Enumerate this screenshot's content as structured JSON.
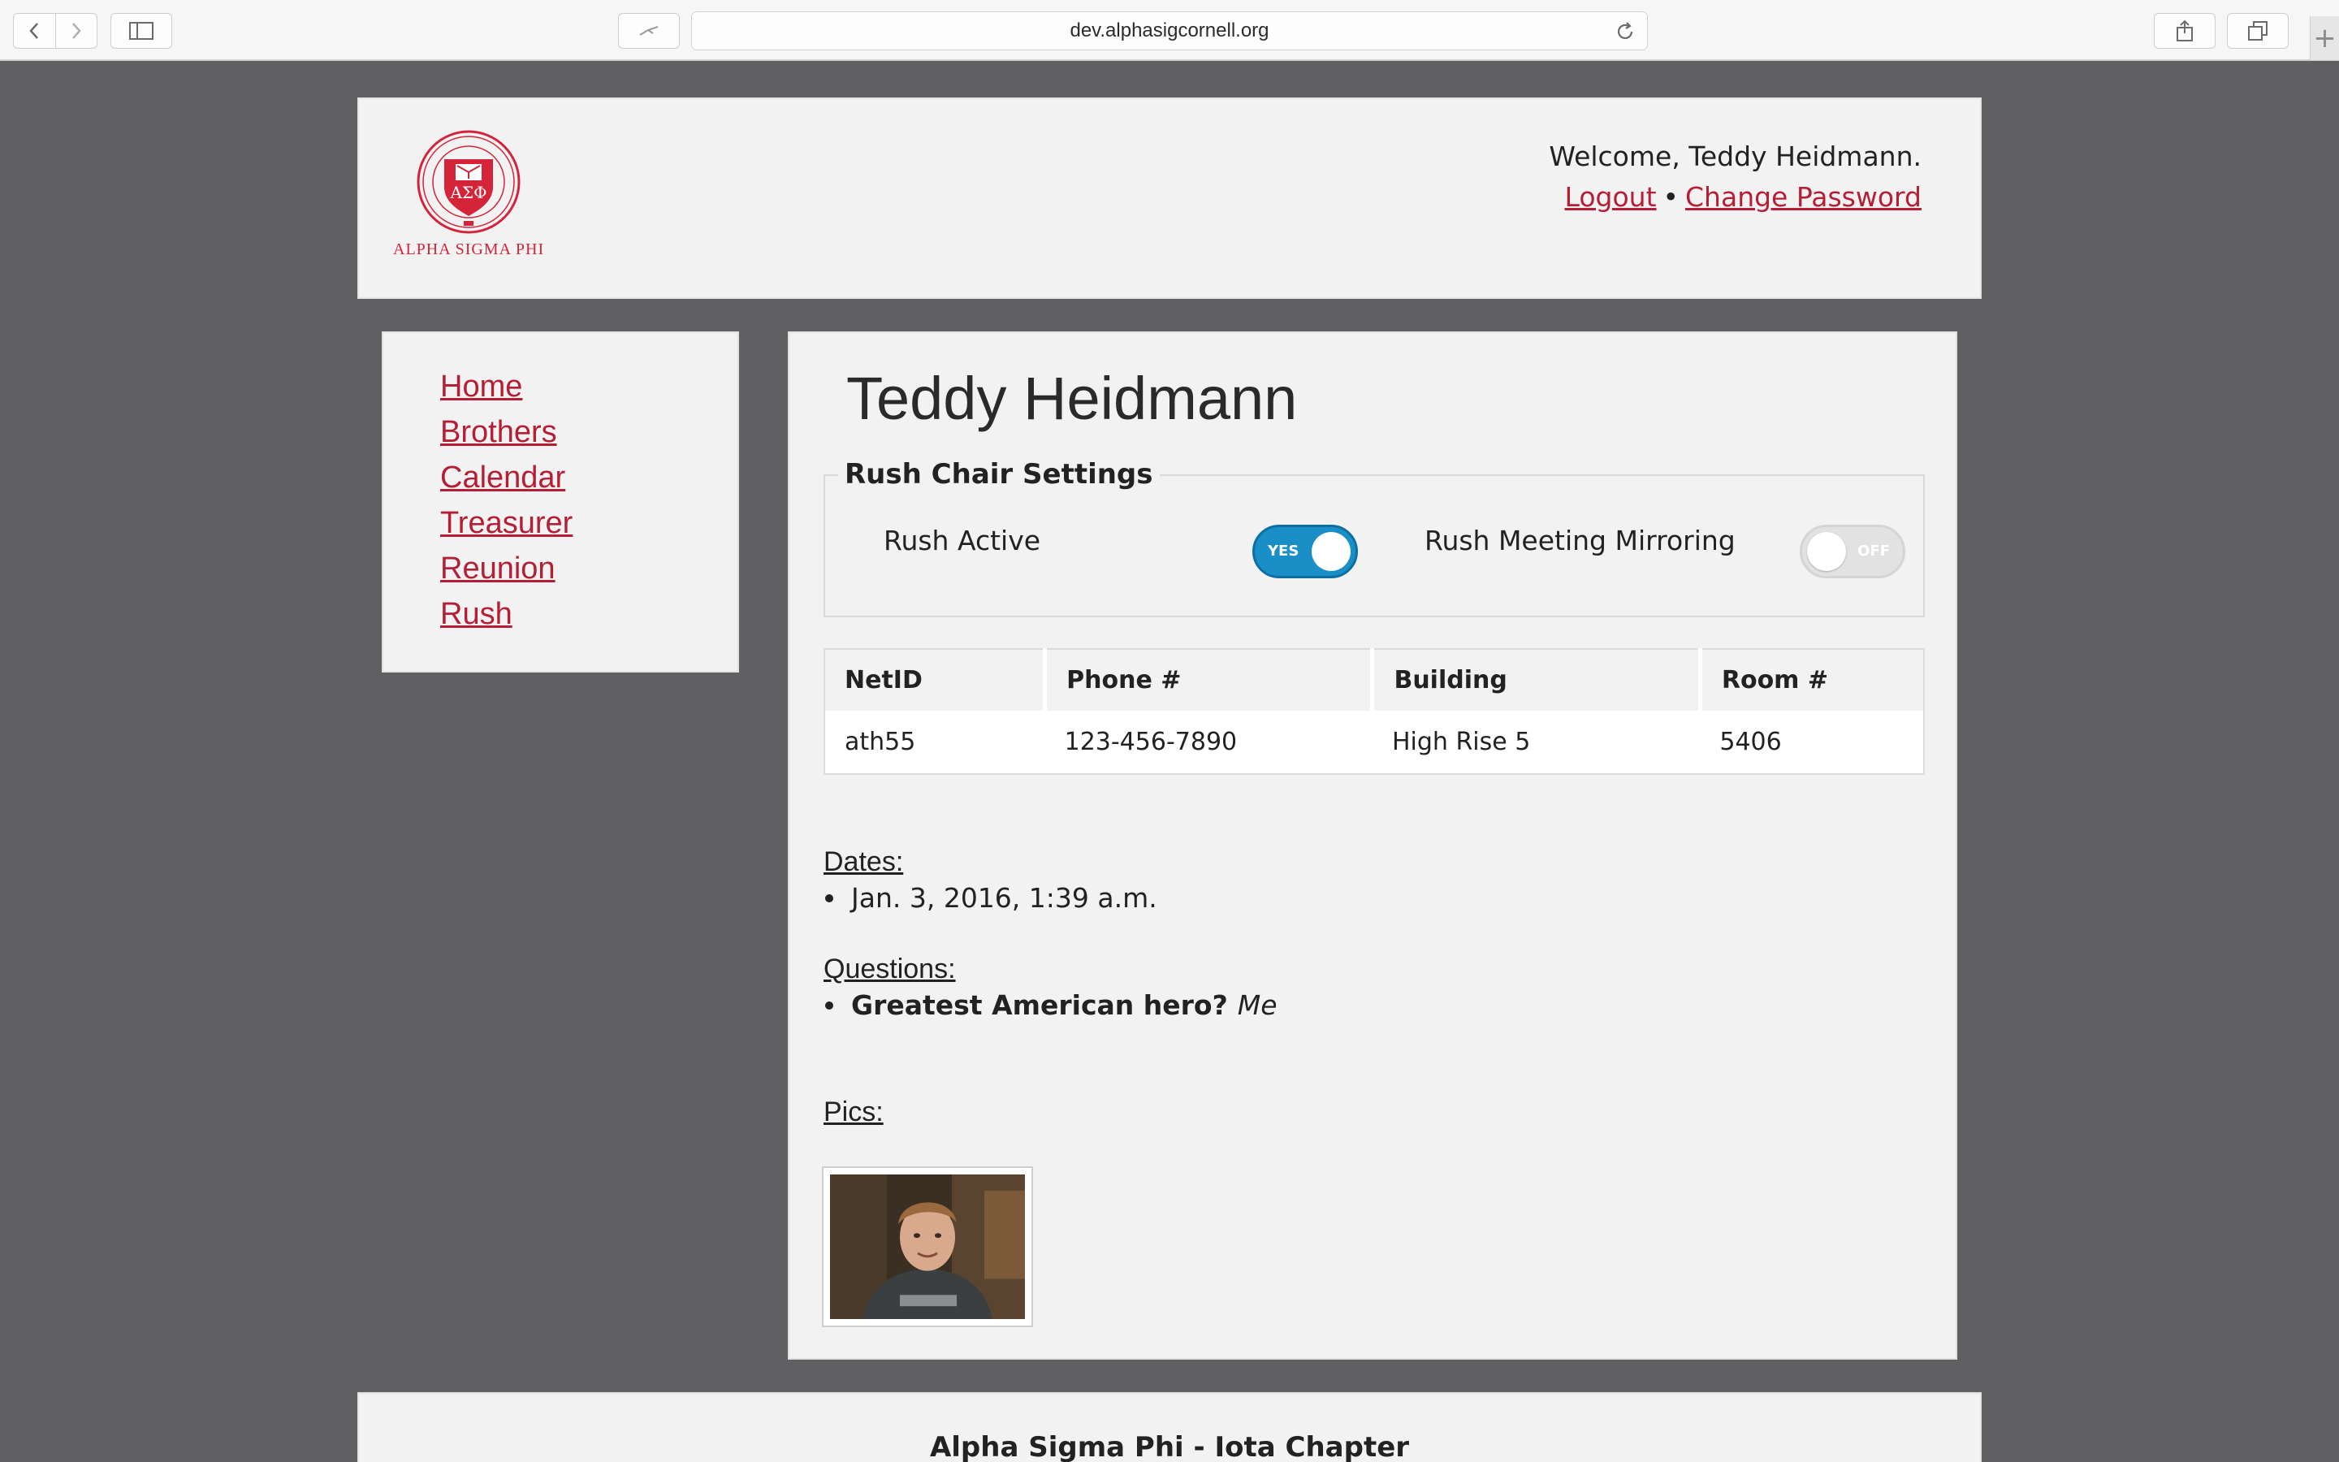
{
  "browser": {
    "url": "dev.alphasigcornell.org",
    "icons": [
      "back-icon",
      "forward-icon",
      "sidebar-icon",
      "pin-icon",
      "reload-icon",
      "share-icon",
      "tabs-icon",
      "new-tab-icon"
    ]
  },
  "header": {
    "logo_text": "ALPHA SIGMA PHI",
    "welcome": "Welcome, Teddy Heidmann.",
    "logout": "Logout",
    "separator": "•",
    "change_password": "Change Password"
  },
  "sidebar": {
    "items": [
      {
        "label": "Home"
      },
      {
        "label": "Brothers"
      },
      {
        "label": "Calendar"
      },
      {
        "label": "Treasurer"
      },
      {
        "label": "Reunion"
      },
      {
        "label": "Rush"
      }
    ]
  },
  "main": {
    "title": "Teddy Heidmann",
    "settings": {
      "legend": "Rush Chair Settings",
      "rush_active_label": "Rush Active",
      "rush_active_state": "YES",
      "mirroring_label": "Rush Meeting Mirroring",
      "mirroring_state": "OFF"
    },
    "table": {
      "headers": [
        "NetID",
        "Phone #",
        "Building",
        "Room #"
      ],
      "row": [
        "ath55",
        "123-456-7890",
        "High Rise 5",
        "5406"
      ]
    },
    "dates_label": "Dates:",
    "dates": [
      "Jan. 3, 2016, 1:39 a.m."
    ],
    "questions_label": "Questions:",
    "questions": [
      {
        "q": "Greatest American hero?",
        "a": "Me"
      }
    ],
    "pics_label": "Pics:"
  },
  "footer": {
    "text": "Alpha Sigma Phi - Iota Chapter"
  },
  "colors": {
    "accent": "#b51f35",
    "toggle_on": "#1a8ec7",
    "page_bg": "#606062",
    "panel_bg": "#f2f2f2"
  }
}
